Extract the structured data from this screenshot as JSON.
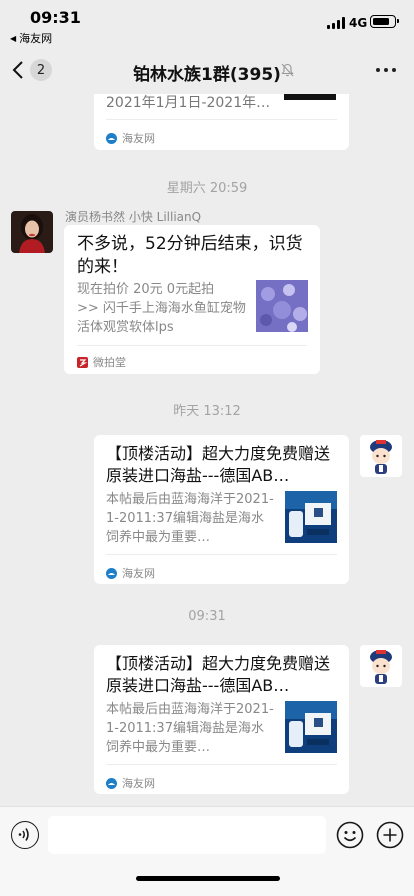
{
  "status_bar": {
    "time": "09:31",
    "back_app": "海友网",
    "network": "4G",
    "icons": [
      "signal-icon",
      "battery-icon",
      "back-arrow-icon"
    ]
  },
  "nav": {
    "unread_count": "2",
    "title": "铂林水族1群(395)",
    "icons": [
      "back-chevron-icon",
      "mute-bell-icon",
      "more-icon"
    ]
  },
  "messages": [
    {
      "type": "link_card_partial",
      "desc": "2021年1月1日-2021年…",
      "source": "海友网"
    },
    {
      "type": "timestamp",
      "text": "星期六 20:59"
    },
    {
      "type": "incoming_card",
      "sender": "演员杨书然 小快 LillianQ",
      "title": "不多说，52分钟后结束，识货的来！",
      "desc": "现在拍价 20元 0元起拍\n>> 闪千手上海海水鱼缸宠物活体观赏软体lps",
      "source": "微拍堂"
    },
    {
      "type": "timestamp",
      "text": "昨天 13:12"
    },
    {
      "type": "outgoing_card",
      "title": "【顶楼活动】超大力度免费赠送原装进口海盐---德国AB…",
      "desc": "本帖最后由蓝海海洋于2021-1-2011:37编辑海盐是海水饲养中最为重要…",
      "source": "海友网"
    },
    {
      "type": "timestamp",
      "text": "09:31"
    },
    {
      "type": "outgoing_card",
      "title": "【顶楼活动】超大力度免费赠送原装进口海盐---德国AB…",
      "desc": "本帖最后由蓝海海洋于2021-1-2011:37编辑海盐是海水饲养中最为重要…",
      "source": "海友网"
    }
  ],
  "input_bar": {
    "value": "",
    "icons": [
      "voice-icon",
      "emoji-icon",
      "plus-icon"
    ]
  },
  "colors": {
    "background": "#ededed",
    "card": "#ffffff",
    "timestamp": "#a3a3a3",
    "secondary_text": "#888888",
    "haiyou_logo": "#1e7fc8",
    "weipaitang_logo": "#c8232a"
  }
}
